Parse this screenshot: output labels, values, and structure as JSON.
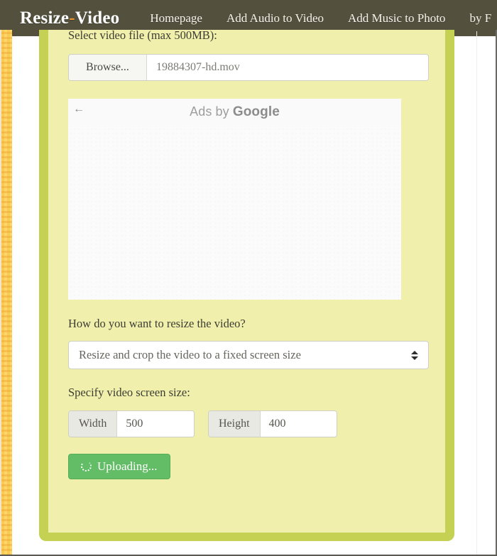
{
  "navbar": {
    "brand_prefix": "Resize",
    "brand_dash": "-",
    "brand_suffix": "Video",
    "links": [
      {
        "label": "Homepage"
      },
      {
        "label": "Add Audio to Video"
      },
      {
        "label": "Add Music to Photo"
      },
      {
        "label": "by F"
      }
    ]
  },
  "form": {
    "file_label": "Select video file (max 500MB):",
    "browse_label": "Browse...",
    "file_name": "19884307-hd.mov",
    "resize_question": "How do you want to resize the video?",
    "resize_selected": "Resize and crop the video to a fixed screen size",
    "size_label": "Specify video screen size:",
    "width_addon": "Width",
    "width_value": "500",
    "height_addon": "Height",
    "height_value": "400",
    "submit_label": "Uploading..."
  },
  "ad": {
    "back_arrow": "←",
    "label_prefix": "Ads by ",
    "label_brand": "Google"
  },
  "colors": {
    "navbar_bg": "#53503e",
    "brand_dash": "#e8942f",
    "panel_border": "#c4d152",
    "panel_bg": "#f0f0ac",
    "submit_bg": "#63bd66",
    "left_strip": "#ffd65e"
  }
}
